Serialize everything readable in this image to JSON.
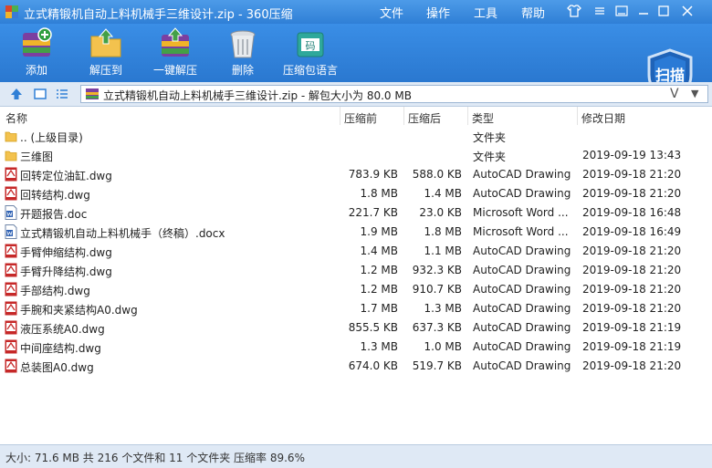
{
  "window": {
    "title": "立式精锻机自动上料机械手三维设计.zip - 360压缩"
  },
  "menu": [
    "文件",
    "操作",
    "工具",
    "帮助"
  ],
  "toolbar": [
    {
      "label": "添加",
      "icon": "add-archive-icon"
    },
    {
      "label": "解压到",
      "icon": "extract-to-icon"
    },
    {
      "label": "一键解压",
      "icon": "one-click-extract-icon"
    },
    {
      "label": "删除",
      "icon": "delete-icon"
    },
    {
      "label": "压缩包语言",
      "icon": "archive-language-icon"
    }
  ],
  "scan_button": "扫描",
  "address": {
    "text": "立式精锻机自动上料机械手三维设计.zip - 解包大小为 80.0 MB",
    "v": "V"
  },
  "columns": {
    "name": "名称",
    "compressed": "压缩前",
    "after": "压缩后",
    "type": "类型",
    "modified": "修改日期"
  },
  "files": [
    {
      "name": ".. (上级目录)",
      "size": "",
      "packed": "",
      "type": "文件夹",
      "date": "",
      "kind": "folder"
    },
    {
      "name": "三维图",
      "size": "",
      "packed": "",
      "type": "文件夹",
      "date": "2019-09-19 13:43",
      "kind": "folder"
    },
    {
      "name": "回转定位油缸.dwg",
      "size": "783.9 KB",
      "packed": "588.0 KB",
      "type": "AutoCAD Drawing",
      "date": "2019-09-18 21:20",
      "kind": "dwg"
    },
    {
      "name": "回转结构.dwg",
      "size": "1.8 MB",
      "packed": "1.4 MB",
      "type": "AutoCAD Drawing",
      "date": "2019-09-18 21:20",
      "kind": "dwg"
    },
    {
      "name": "开题报告.doc",
      "size": "221.7 KB",
      "packed": "23.0 KB",
      "type": "Microsoft Word ...",
      "date": "2019-09-18 16:48",
      "kind": "doc"
    },
    {
      "name": "立式精锻机自动上料机械手（终稿）.docx",
      "size": "1.9 MB",
      "packed": "1.8 MB",
      "type": "Microsoft Word ...",
      "date": "2019-09-18 16:49",
      "kind": "doc"
    },
    {
      "name": "手臂伸缩结构.dwg",
      "size": "1.4 MB",
      "packed": "1.1 MB",
      "type": "AutoCAD Drawing",
      "date": "2019-09-18 21:20",
      "kind": "dwg"
    },
    {
      "name": "手臂升降结构.dwg",
      "size": "1.2 MB",
      "packed": "932.3 KB",
      "type": "AutoCAD Drawing",
      "date": "2019-09-18 21:20",
      "kind": "dwg"
    },
    {
      "name": "手部结构.dwg",
      "size": "1.2 MB",
      "packed": "910.7 KB",
      "type": "AutoCAD Drawing",
      "date": "2019-09-18 21:20",
      "kind": "dwg"
    },
    {
      "name": "手腕和夹紧结构A0.dwg",
      "size": "1.7 MB",
      "packed": "1.3 MB",
      "type": "AutoCAD Drawing",
      "date": "2019-09-18 21:20",
      "kind": "dwg"
    },
    {
      "name": "液压系统A0.dwg",
      "size": "855.5 KB",
      "packed": "637.3 KB",
      "type": "AutoCAD Drawing",
      "date": "2019-09-18 21:19",
      "kind": "dwg"
    },
    {
      "name": "中间座结构.dwg",
      "size": "1.3 MB",
      "packed": "1.0 MB",
      "type": "AutoCAD Drawing",
      "date": "2019-09-18 21:19",
      "kind": "dwg"
    },
    {
      "name": "总装图A0.dwg",
      "size": "674.0 KB",
      "packed": "519.7 KB",
      "type": "AutoCAD Drawing",
      "date": "2019-09-18 21:20",
      "kind": "dwg"
    }
  ],
  "status": "大小: 71.6 MB 共 216 个文件和 11 个文件夹 压缩率 89.6%",
  "colors": {
    "titlebar": "#2f7fd6",
    "toolbar": "#3a8ee6",
    "folder": "#f3c24e",
    "dwg": "#c62828",
    "doc": "#2b5fb3"
  }
}
